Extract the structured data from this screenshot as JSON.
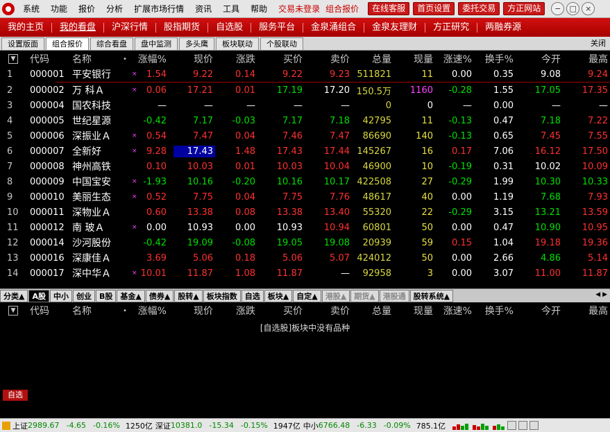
{
  "titlebar": {
    "menu": [
      "系统",
      "功能",
      "报价",
      "分析",
      "扩展市场行情",
      "资讯",
      "工具",
      "帮助"
    ],
    "login_status": "交易未登录",
    "mode_label": "组合报价",
    "buttons": [
      "在线客服",
      "首页设置",
      "委托交易",
      "方正网站"
    ]
  },
  "navbar": {
    "items": [
      "我的主页",
      "我的看盘",
      "沪深行情",
      "股指期货",
      "自选股",
      "服务平台",
      "金泉涌组合",
      "金泉友理财",
      "方正研究",
      "两融券源"
    ],
    "active_index": 1
  },
  "tabbar": {
    "tabs": [
      "设置版面",
      "组合报价",
      "综合看盘",
      "盘中监测",
      "多头鹰",
      "板块联动",
      "个股联动"
    ],
    "active_index": 1,
    "close_label": "关闭"
  },
  "columns": [
    "代码",
    "名称",
    "•",
    "涨幅%",
    "现价",
    "涨跌",
    "买价",
    "卖价",
    "总量",
    "现量",
    "涨速%",
    "换手%",
    "今开",
    "最高"
  ],
  "rows": [
    {
      "idx": "1",
      "code": "000001",
      "name": "平安银行",
      "mark": "×",
      "chg_pct": "1.54",
      "price": "9.22",
      "chg": "0.14",
      "bid": "9.22",
      "ask": "9.23",
      "vol": "511821",
      "cur_vol": "11",
      "speed": "0.00",
      "turnover": "0.35",
      "open": "9.08",
      "high": "9.24",
      "dir": "up"
    },
    {
      "idx": "2",
      "code": "000002",
      "name": "万 科Ａ",
      "mark": "×",
      "chg_pct": "0.06",
      "price": "17.21",
      "chg": "0.01",
      "bid": "17.19",
      "ask": "17.20",
      "vol": "150.5万",
      "cur_vol": "1160",
      "speed": "-0.28",
      "turnover": "1.55",
      "open": "17.05",
      "high": "17.35",
      "dir": "up"
    },
    {
      "idx": "3",
      "code": "000004",
      "name": "国农科技",
      "mark": "",
      "chg_pct": "—",
      "price": "—",
      "chg": "—",
      "bid": "—",
      "ask": "—",
      "vol": "0",
      "cur_vol": "0",
      "speed": "—",
      "turnover": "0.00",
      "open": "—",
      "high": "—",
      "dir": "flat"
    },
    {
      "idx": "4",
      "code": "000005",
      "name": "世纪星源",
      "mark": "",
      "chg_pct": "-0.42",
      "price": "7.17",
      "chg": "-0.03",
      "bid": "7.17",
      "ask": "7.18",
      "vol": "42795",
      "cur_vol": "11",
      "speed": "-0.13",
      "turnover": "0.47",
      "open": "7.18",
      "high": "7.22",
      "dir": "down"
    },
    {
      "idx": "5",
      "code": "000006",
      "name": "深振业Ａ",
      "mark": "×",
      "chg_pct": "0.54",
      "price": "7.47",
      "chg": "0.04",
      "bid": "7.46",
      "ask": "7.47",
      "vol": "86690",
      "cur_vol": "140",
      "speed": "-0.13",
      "turnover": "0.65",
      "open": "7.45",
      "high": "7.55",
      "dir": "up"
    },
    {
      "idx": "6",
      "code": "000007",
      "name": "全新好",
      "mark": "×",
      "chg_pct": "9.28",
      "price": "17.43",
      "chg": "1.48",
      "bid": "17.43",
      "ask": "17.44",
      "vol": "145267",
      "cur_vol": "16",
      "speed": "0.17",
      "turnover": "7.06",
      "open": "16.12",
      "high": "17.50",
      "dir": "up",
      "selected": true
    },
    {
      "idx": "7",
      "code": "000008",
      "name": "神州高铁",
      "mark": "",
      "chg_pct": "0.10",
      "price": "10.03",
      "chg": "0.01",
      "bid": "10.03",
      "ask": "10.04",
      "vol": "46900",
      "cur_vol": "10",
      "speed": "-0.19",
      "turnover": "0.31",
      "open": "10.02",
      "high": "10.09",
      "dir": "up"
    },
    {
      "idx": "8",
      "code": "000009",
      "name": "中国宝安",
      "mark": "×",
      "chg_pct": "-1.93",
      "price": "10.16",
      "chg": "-0.20",
      "bid": "10.16",
      "ask": "10.17",
      "vol": "422508",
      "cur_vol": "27",
      "speed": "-0.29",
      "turnover": "1.99",
      "open": "10.30",
      "high": "10.33",
      "dir": "down"
    },
    {
      "idx": "9",
      "code": "000010",
      "name": "美丽生态",
      "mark": "×",
      "chg_pct": "0.52",
      "price": "7.75",
      "chg": "0.04",
      "bid": "7.75",
      "ask": "7.76",
      "vol": "48617",
      "cur_vol": "40",
      "speed": "0.00",
      "turnover": "1.19",
      "open": "7.68",
      "high": "7.93",
      "dir": "up"
    },
    {
      "idx": "10",
      "code": "000011",
      "name": "深物业Ａ",
      "mark": "",
      "chg_pct": "0.60",
      "price": "13.38",
      "chg": "0.08",
      "bid": "13.38",
      "ask": "13.40",
      "vol": "55320",
      "cur_vol": "22",
      "speed": "-0.29",
      "turnover": "3.15",
      "open": "13.21",
      "high": "13.59",
      "dir": "up"
    },
    {
      "idx": "11",
      "code": "000012",
      "name": "南 玻Ａ",
      "mark": "×",
      "chg_pct": "0.00",
      "price": "10.93",
      "chg": "0.00",
      "bid": "10.93",
      "ask": "10.94",
      "vol": "60801",
      "cur_vol": "50",
      "speed": "0.00",
      "turnover": "0.47",
      "open": "10.90",
      "high": "10.95",
      "dir": "flat"
    },
    {
      "idx": "12",
      "code": "000014",
      "name": "沙河股份",
      "mark": "",
      "chg_pct": "-0.42",
      "price": "19.09",
      "chg": "-0.08",
      "bid": "19.05",
      "ask": "19.08",
      "vol": "20939",
      "cur_vol": "59",
      "speed": "0.15",
      "turnover": "1.04",
      "open": "19.18",
      "high": "19.36",
      "dir": "down"
    },
    {
      "idx": "13",
      "code": "000016",
      "name": "深康佳Ａ",
      "mark": "",
      "chg_pct": "3.69",
      "price": "5.06",
      "chg": "0.18",
      "bid": "5.06",
      "ask": "5.07",
      "vol": "424012",
      "cur_vol": "50",
      "speed": "0.00",
      "turnover": "2.66",
      "open": "4.86",
      "high": "5.14",
      "dir": "up"
    },
    {
      "idx": "14",
      "code": "000017",
      "name": "深中华Ａ",
      "mark": "×",
      "chg_pct": "10.01",
      "price": "11.87",
      "chg": "1.08",
      "bid": "11.87",
      "ask": "—",
      "vol": "92958",
      "cur_vol": "3",
      "speed": "0.00",
      "turnover": "3.07",
      "open": "11.00",
      "high": "11.87",
      "dir": "up"
    }
  ],
  "category_tabs": [
    "分类▲",
    "A股",
    "中小",
    "创业",
    "B股",
    "基金▲",
    "债券▲",
    "股转▲",
    "板块指数",
    "自选",
    "板块▲",
    "自定▲",
    "港股▲",
    "期货▲",
    "港股通",
    "股转系统▲"
  ],
  "category_active_index": 1,
  "lower_columns": [
    "代码",
    "名称",
    "•",
    "涨幅%",
    "现价",
    "涨跌",
    "买价",
    "卖价",
    "总量",
    "现量",
    "涨速%",
    "换手%",
    "今开",
    "最高"
  ],
  "empty_message": "[自选股]板块中没有品种",
  "zixuan_tag": "自选",
  "statusbar": {
    "sh_label": "上证",
    "sh_value": "2989.67",
    "sh_chg": "-4.65",
    "sh_pct": "-0.16%",
    "sh_amt": "1250亿",
    "sz_label": "深证",
    "sz_value": "10381.0",
    "sz_chg": "-15.34",
    "sz_pct": "-0.15%",
    "sz_amt": "1947亿",
    "zx_label": "中小",
    "zx_value": "6766.48",
    "zx_chg": "-6.33",
    "zx_pct": "-0.09%",
    "zx_amt": "785.1亿"
  },
  "colors": {
    "up": "#ff3030",
    "down": "#00e000",
    "brand": "#c80000"
  }
}
